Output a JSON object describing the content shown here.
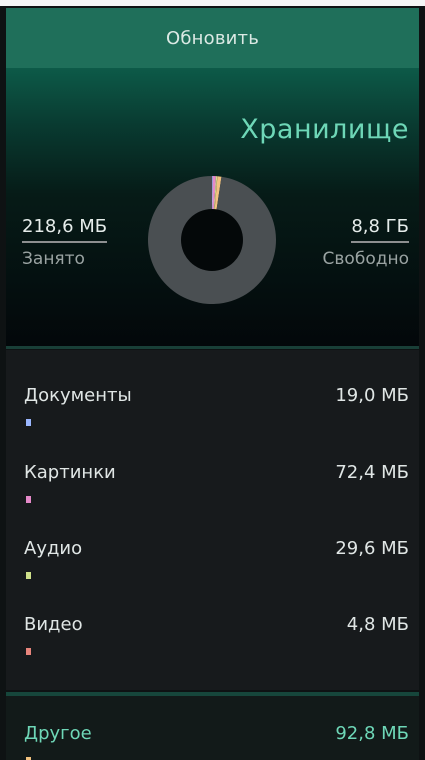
{
  "pulley": {
    "refresh_label": "Обновить"
  },
  "page": {
    "title": "Хранилище"
  },
  "stats": {
    "used_value": "218,6 МБ",
    "used_label": "Занято",
    "free_value": "8,8 ГБ",
    "free_label": "Свободно"
  },
  "chart_data": {
    "type": "pie",
    "title": "",
    "categories": [
      "Документы",
      "Картинки",
      "Аудио",
      "Видео",
      "Другое",
      "Свободно"
    ],
    "values": [
      19.0,
      72.4,
      29.6,
      4.8,
      92.8,
      9011.2
    ],
    "units": "МБ"
  },
  "categories": [
    {
      "name": "Документы",
      "size": "19,0 МБ",
      "color": "#9bb7ff"
    },
    {
      "name": "Картинки",
      "size": "72,4 МБ",
      "color": "#e58ac9"
    },
    {
      "name": "Аудио",
      "size": "29,6 МБ",
      "color": "#cfe08a"
    },
    {
      "name": "Видео",
      "size": "4,8 МБ",
      "color": "#e8857c"
    }
  ],
  "other": {
    "name": "Другое",
    "size": "92,8 МБ",
    "color": "#f2c27f"
  },
  "colors": {
    "accent": "#6ed7b7",
    "free_segment": "#4a4f52"
  }
}
